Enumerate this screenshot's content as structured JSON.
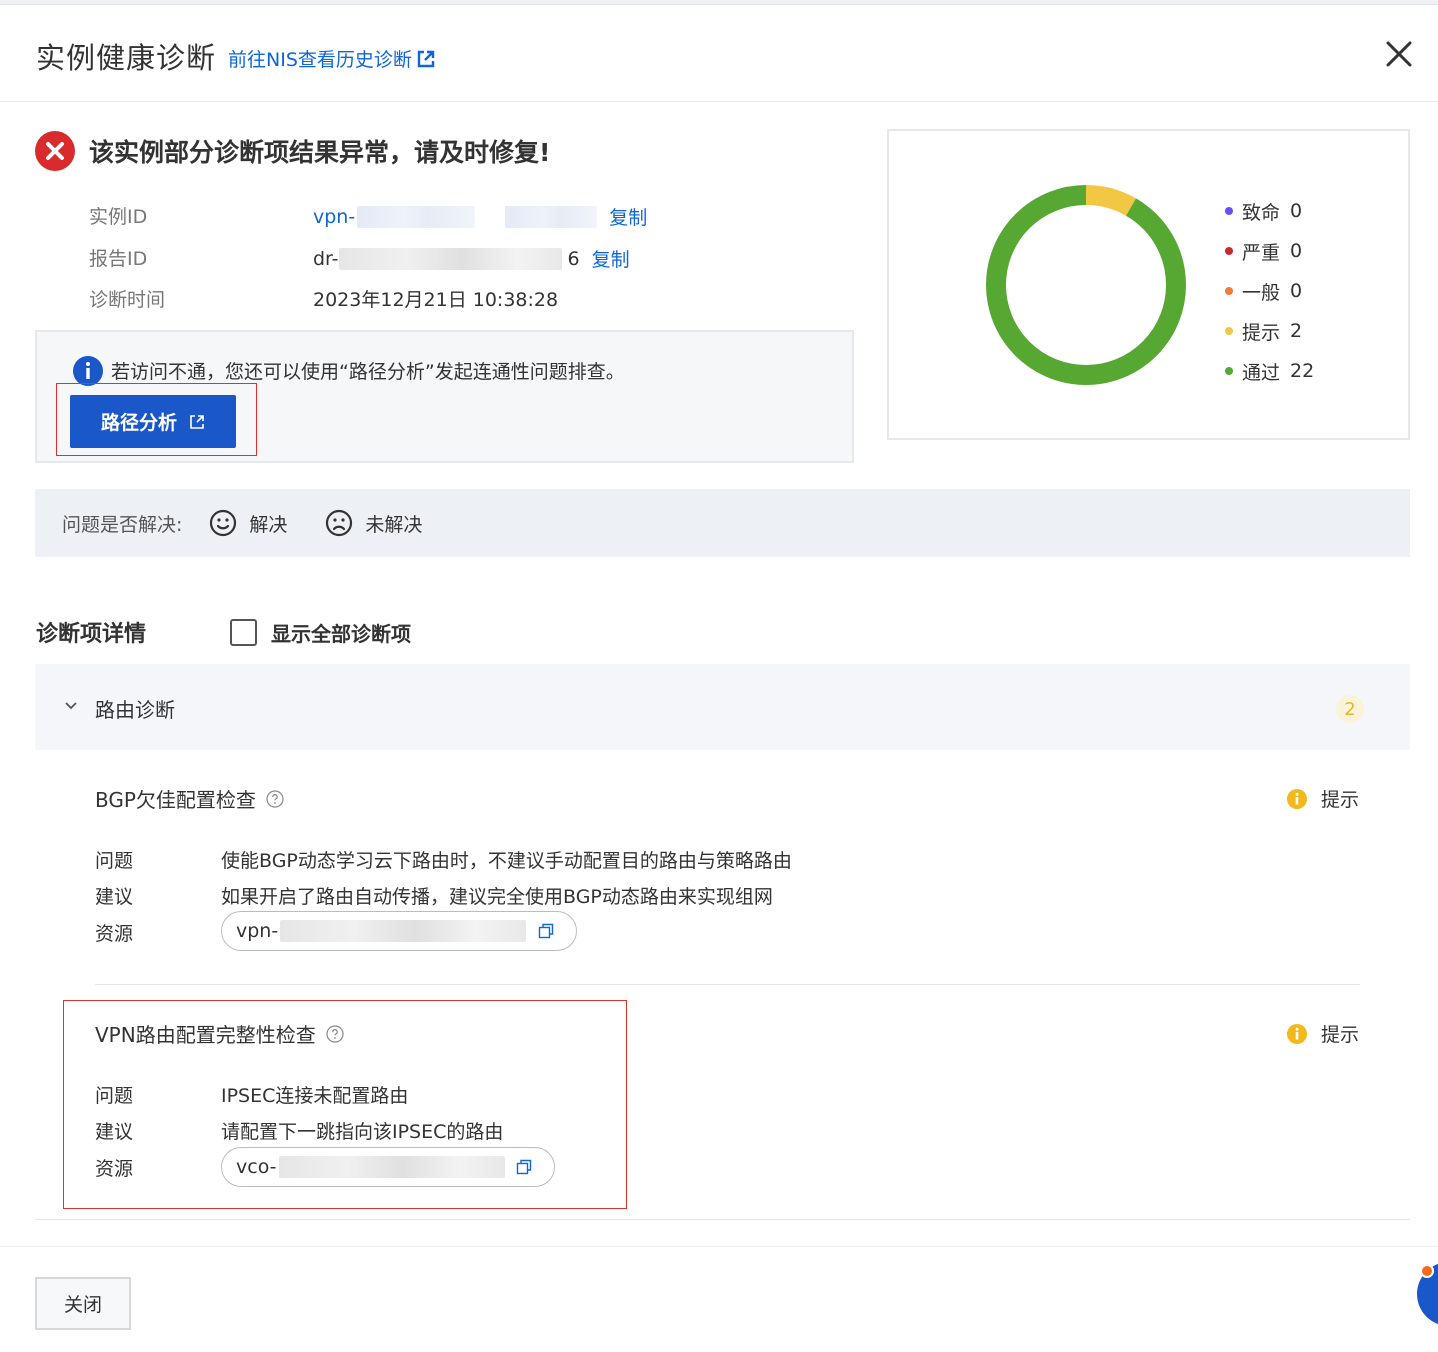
{
  "header": {
    "title": "实例健康诊断",
    "history_link": "前往NIS查看历史诊断"
  },
  "alert": {
    "title": "该实例部分诊断项结果异常，请及时修复!"
  },
  "info": {
    "instance_label": "实例ID",
    "instance_prefix": "vpn-",
    "report_label": "报告ID",
    "report_prefix": "dr-",
    "report_suffix": "6",
    "time_label": "诊断时间",
    "time_value": "2023年12月21日 10:38:28",
    "copy_label": "复制"
  },
  "notice": {
    "text": "若访问不通，您还可以使用“路径分析”发起连通性问题排查。",
    "button": "路径分析"
  },
  "chart_data": {
    "type": "pie",
    "title": "",
    "categories": [
      "致命",
      "严重",
      "一般",
      "提示",
      "通过"
    ],
    "values": [
      0,
      0,
      0,
      2,
      22
    ],
    "colors": [
      "#6a4df5",
      "#cc2a2a",
      "#f07a3a",
      "#f2c744",
      "#56a832"
    ]
  },
  "resolve": {
    "question": "问题是否解决:",
    "yes": "解决",
    "no": "未解决"
  },
  "details": {
    "title": "诊断项详情",
    "show_all": "显示全部诊断项",
    "section_name": "路由诊断",
    "section_count": "2",
    "row_labels": {
      "problem": "问题",
      "advice": "建议",
      "resource": "资源"
    },
    "checks": [
      {
        "name": "BGP欠佳配置检查",
        "level": "提示",
        "problem": "使能BGP动态学习云下路由时，不建议手动配置目的路由与策略路由",
        "advice": "如果开启了路由自动传播，建议完全使用BGP动态路由来实现组网",
        "resource_prefix": "vpn-"
      },
      {
        "name": "VPN路由配置完整性检查",
        "level": "提示",
        "problem": "IPSEC连接未配置路由",
        "advice": "请配置下一跳指向该IPSEC的路由",
        "resource_prefix": "vco-"
      }
    ]
  },
  "footer": {
    "close": "关闭"
  }
}
